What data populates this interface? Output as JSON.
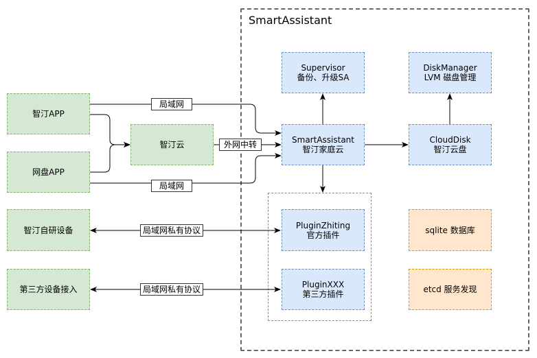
{
  "frame": {
    "title": "SmartAssistant"
  },
  "clients": {
    "app": "智汀APP",
    "disk_app": "网盘APP",
    "cloud": "智汀云",
    "own_device": "智汀自研设备",
    "third_device": "第三方设备接入"
  },
  "services": {
    "supervisor": {
      "line1": "Supervisor",
      "line2": "备份、升级SA"
    },
    "disk_manager": {
      "line1": "DiskManager",
      "line2": "LVM 磁盘管理"
    },
    "smart_assistant": {
      "line1": "SmartAssistant",
      "line2": "智汀家庭云"
    },
    "cloud_disk": {
      "line1": "CloudDisk",
      "line2": "智汀云盘"
    },
    "plugin_zhiting": {
      "line1": "PluginZhiting",
      "line2": "官方插件"
    },
    "plugin_xxx": {
      "line1": "PluginXXX",
      "line2": "第三方插件"
    },
    "sqlite": "sqlite 数据库",
    "etcd": "etcd 服务发现"
  },
  "edge_labels": {
    "lan_top": "局域网",
    "wan_relay": "外网中转",
    "lan_bottom": "局域网",
    "private_1": "局域网私有协议",
    "private_2": "局域网私有协议"
  },
  "colors": {
    "green_fill": "#d5e8d4",
    "green_stroke": "#82b366",
    "blue_fill": "#dae8fc",
    "blue_stroke": "#6c8ebf",
    "orange_fill": "#ffe6cc",
    "orange_stroke": "#d79b00"
  }
}
